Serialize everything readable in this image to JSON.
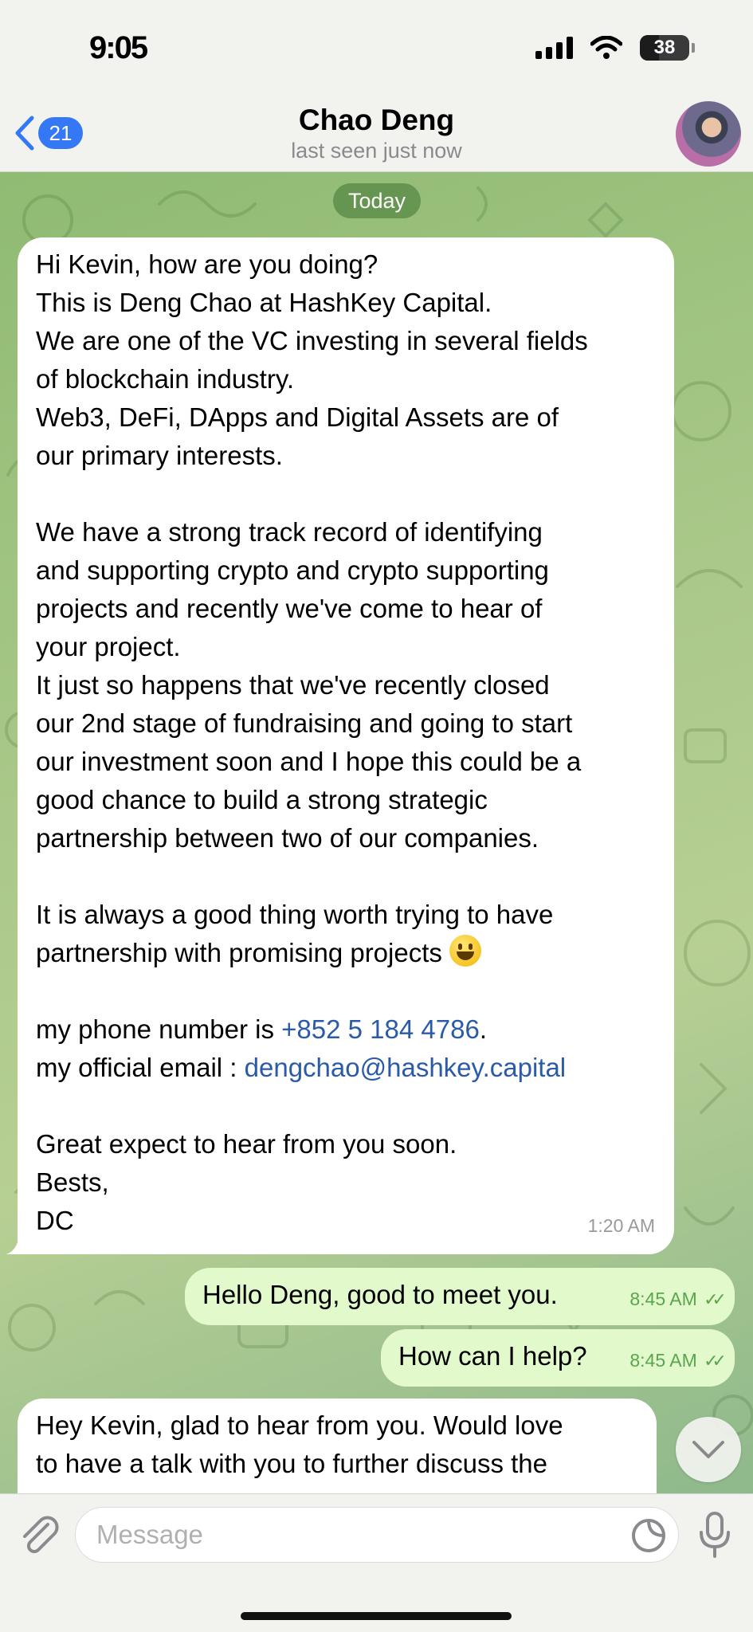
{
  "status_bar": {
    "time": "9:05",
    "battery": "38",
    "battery_level": 0.38
  },
  "header": {
    "back_badge": "21",
    "contact_name": "Chao Deng",
    "contact_status": "last seen just now"
  },
  "chat": {
    "date_separator": "Today",
    "messages": [
      {
        "direction": "incoming",
        "lines": [
          "Hi Kevin, how are you doing?",
          "This is Deng Chao at HashKey Capital.",
          "We are one of the VC investing in several fields",
          "of blockchain industry.",
          "Web3, DeFi, DApps and Digital Assets are of",
          "our primary interests.",
          "",
          "We have a strong track record of identifying",
          "and supporting crypto and crypto supporting",
          "projects and recently we've come to hear of",
          "your project.",
          "It just so happens that we've recently closed",
          "our 2nd stage of fundraising and going to start",
          "our investment soon and I hope this could be a",
          "good chance to build a strong strategic",
          "partnership between two of our companies.",
          "",
          "It is always a good thing worth trying to have",
          "partnership with promising projects",
          "",
          "my phone number is ",
          "my official email : ",
          "",
          "Great expect to hear from you soon.",
          "Bests,",
          "DC"
        ],
        "phone": "+852 5 184 4786",
        "phone_suffix": ".",
        "email": "dengchao@hashkey.capital",
        "emoji": "smiley",
        "time": "1:20 AM"
      },
      {
        "direction": "outgoing",
        "text": "Hello Deng, good to meet you.",
        "time": "8:45 AM",
        "status": "read"
      },
      {
        "direction": "outgoing",
        "text": "How can I help?",
        "time": "8:45 AM",
        "status": "read"
      },
      {
        "direction": "incoming",
        "lines": [
          "Hey Kevin, glad to hear from you. Would love",
          "to have a talk with you to further discuss the"
        ]
      }
    ]
  },
  "input": {
    "placeholder": "Message"
  },
  "colors": {
    "accent": "#3478f6",
    "incoming_bubble": "#ffffff",
    "outgoing_bubble": "#e2f9cc",
    "link": "#2b5ba8",
    "read_check": "#5aa64c"
  },
  "icons": [
    "back-chevron-icon",
    "wifi-icon",
    "signal-icon",
    "battery-icon",
    "paperclip-icon",
    "sticker-icon",
    "microphone-icon",
    "chevron-down-icon"
  ]
}
